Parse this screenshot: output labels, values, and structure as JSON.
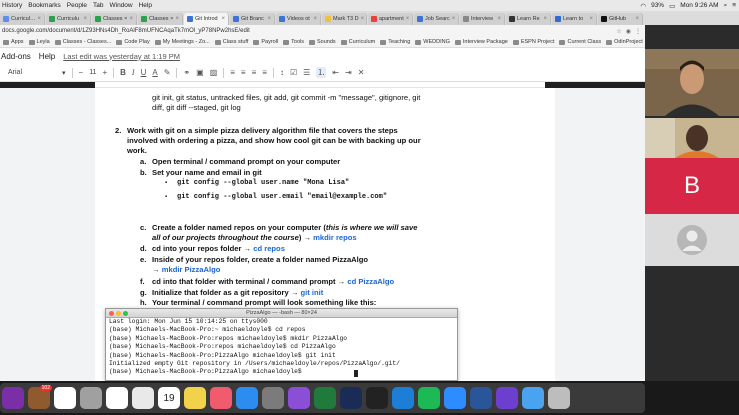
{
  "menubar": {
    "items": [
      "History",
      "Bookmarks",
      "People",
      "Tab",
      "Window",
      "Help"
    ],
    "battery": "93%",
    "clock": "Mon 9:26 AM"
  },
  "tabs": [
    {
      "label": "Curricul…",
      "color": "#5b8ef0"
    },
    {
      "label": "Curriculu",
      "color": "#2e9e4f"
    },
    {
      "label": "Classes ×",
      "color": "#2e9e4f"
    },
    {
      "label": "Classes ×",
      "color": "#2e9e4f"
    },
    {
      "label": "Git Introd",
      "color": "#3b74d8"
    },
    {
      "label": "Git Branc",
      "color": "#3b74d8"
    },
    {
      "label": "Videos ot",
      "color": "#3b74d8"
    },
    {
      "label": "Mark T3 D",
      "color": "#f0c13a"
    },
    {
      "label": "apartment",
      "color": "#e94235"
    },
    {
      "label": "Job Searc",
      "color": "#3b74d8"
    },
    {
      "label": "Interview",
      "color": "#888888"
    },
    {
      "label": "Learn Re",
      "color": "#333333"
    },
    {
      "label": "Learn to",
      "color": "#2e6bd6"
    },
    {
      "label": "GitHub",
      "color": "#111111"
    }
  ],
  "url": "docs.google.com/document/d/1Z93HNs4Dh_RoAlF8mUFNCAqaTk7mOl_yP78NPw2hsE/edit",
  "bookmarks": [
    "Apps",
    "Leyla",
    "Classes - Classes...",
    "Code Play",
    "My Meetings - Zo...",
    "Class stuff",
    "Payroll",
    "Tools",
    "Sounds",
    "Curriculum",
    "Teaching",
    "WEDDING",
    "Interview Package",
    "ESPN Project",
    "Current Class",
    "OdinProject"
  ],
  "docs_menu": {
    "addons": "Add-ons",
    "help": "Help",
    "last_edit": "Last edit was yesterday at 1:19 PM"
  },
  "toolbar": {
    "font": "Arial",
    "size": "11"
  },
  "document": {
    "top_line1": "git init, git status, untracked files, git add, git commit -m \"message\", gitignore, git",
    "top_line2": "diff, git diff --staged, git log",
    "item2_num": "2.",
    "item2_l1": "Work with git on a simple pizza delivery algorithm file that covers the steps",
    "item2_l2": "involved with ordering a pizza, and show how cool git can be with backing up our",
    "item2_l3": "work.",
    "a_letter": "a.",
    "a_text": "Open terminal / command prompt on your computer",
    "b_letter": "b.",
    "b_text": "Set your name and email in git",
    "b1_bullet": "▪",
    "b1_text": "git config --global user.name \"Mona Lisa\"",
    "b2_bullet": "▪",
    "b2_text": "git config --global user.email \"email@example.com\"",
    "c_letter": "c.",
    "c_text1": "Create a folder named repos on your computer (",
    "c_italic1": "this is where we will save",
    "c_italic2": "all of our projects throughout the course",
    "c_text2": ") → ",
    "c_cmd": "mkdir repos",
    "d_letter": "d.",
    "d_text": "cd into your repos folder → ",
    "d_cmd": "cd repos",
    "e_letter": "e.",
    "e_text": "Inside of your repos folder, create a folder named PizzaAlgo",
    "e_text2": "→ ",
    "e_cmd": "mkdir PizzaAlgo",
    "f_letter": "f.",
    "f_text": "cd into that folder with terminal / command prompt → ",
    "f_cmd": "cd PizzaAlgo",
    "g_letter": "g.",
    "g_text": "Initialize that folder as a git repository → ",
    "g_cmd": "git init",
    "h_letter": "h.",
    "h_text": "Your terminal / command prompt will look something like this:"
  },
  "terminal": {
    "title": "PizzaAlgo — -bash — 80×24",
    "lines": [
      "Last login: Mon Jun 15 10:14:25 on ttys000",
      "(base) Michaels-MacBook-Pro:~ michaeldoyle$ cd repos",
      "(base) Michaels-MacBook-Pro:repos michaeldoyle$ mkdir PizzaAlgo",
      "(base) Michaels-MacBook-Pro:repos michaeldoyle$ cd PizzaAlgo",
      "(base) Michaels-MacBook-Pro:PizzaAlgo michaeldoyle$ git init",
      "Initialized empty Git repository in /Users/michaeldoyle/repos/PizzaAlgo/.git/",
      "(base) Michaels-MacBook-Pro:PizzaAlgo michaeldoyle$ "
    ]
  },
  "video": {
    "participant_initial": "B"
  },
  "dock": {
    "apps": [
      {
        "name": "onenote-icon",
        "color": "#7a2fa6"
      },
      {
        "name": "messages-badge-icon",
        "color": "#8f5a2e",
        "badge": "102"
      },
      {
        "name": "slack-icon",
        "color": "#ffffff"
      },
      {
        "name": "settings-icon",
        "color": "#a0a0a0"
      },
      {
        "name": "chrome-icon",
        "color": "#ffffff"
      },
      {
        "name": "photos-icon",
        "color": "#e9e9e9"
      },
      {
        "name": "calendar-icon",
        "color": "#ffffff"
      },
      {
        "name": "notes-icon",
        "color": "#f3d24b"
      },
      {
        "name": "music-icon",
        "color": "#f05b6d"
      },
      {
        "name": "appstore-icon",
        "color": "#2d8cf0"
      },
      {
        "name": "system-prefs-icon",
        "color": "#7b7b7b"
      },
      {
        "name": "visual-studio-icon",
        "color": "#8a4fd6"
      },
      {
        "name": "excel-icon",
        "color": "#1f7a3c"
      },
      {
        "name": "anaconda-icon",
        "color": "#1a2c56"
      },
      {
        "name": "terminal-icon",
        "color": "#222222"
      },
      {
        "name": "vscode-icon",
        "color": "#1d7ed6"
      },
      {
        "name": "spotify-icon",
        "color": "#1db954"
      },
      {
        "name": "zoom-icon",
        "color": "#2d8cff"
      },
      {
        "name": "word-icon",
        "color": "#2a5699"
      },
      {
        "name": "visual-studio-mac-icon",
        "color": "#6d3fcf"
      },
      {
        "name": "finder-icon",
        "color": "#4aa3f0"
      },
      {
        "name": "trash-icon",
        "color": "#bdbdbd"
      }
    ],
    "calendar_day": "19"
  }
}
